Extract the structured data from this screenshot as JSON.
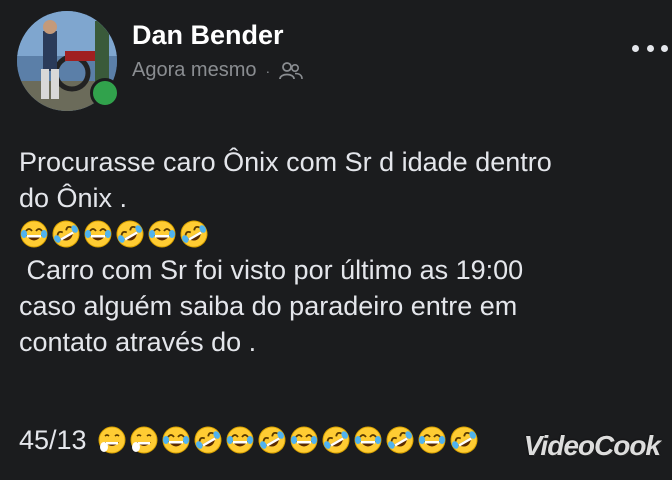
{
  "post": {
    "author": "Dan Bender",
    "timestamp": "Agora mesmo",
    "separator": "·",
    "audience_icon": "friends-icon",
    "more_icon": "more-options-icon",
    "online": true,
    "lines": [
      "Procurasse caro Ônix com Sr d idade dentro",
      "do Ônix ."
    ],
    "emoji_row_1": [
      "joy",
      "rofl",
      "joy",
      "rofl",
      "joy",
      "rofl"
    ],
    "lines_2": [
      " Carro com Sr foi visto por último as 19:00",
      "caso alguém saiba do paradeiro entre em",
      "contato através do ."
    ],
    "code": "45/13",
    "emoji_row_2": [
      "cold-sweat",
      "cold-sweat",
      "joy",
      "rofl",
      "joy",
      "rofl",
      "joy",
      "rofl",
      "joy",
      "rofl",
      "joy",
      "rofl"
    ]
  },
  "watermark": "VideoCook",
  "colors": {
    "background": "#1b1c1e",
    "text": "#e4e6eb",
    "muted": "#8a8d91",
    "online": "#31a24c",
    "emoji_face": "#ffcc33"
  }
}
